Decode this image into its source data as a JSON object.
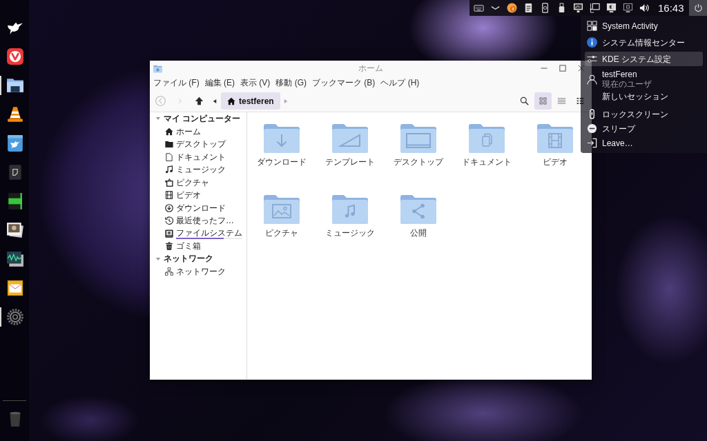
{
  "top_panel": {
    "clock": "16:43",
    "power_button": {
      "active": true
    }
  },
  "dock": {
    "items": [
      {
        "running": false
      },
      {
        "running": false
      },
      {
        "running": true
      },
      {
        "running": false
      },
      {
        "running": false
      },
      {
        "running": false
      },
      {
        "running": false
      },
      {
        "running": false
      },
      {
        "running": false
      },
      {
        "running": false
      },
      {
        "running": true
      }
    ]
  },
  "window": {
    "title": "ホーム",
    "menu": [
      "ファイル (F)",
      "編集 (E)",
      "表示 (V)",
      "移動 (G)",
      "ブックマーク (B)",
      "ヘルプ (H)"
    ],
    "toolbar": {
      "nav": [
        {
          "disabled": true
        },
        {
          "disabled": true
        },
        {
          "disabled": false
        }
      ],
      "breadcrumb": "testferen",
      "view_modes": [
        {
          "selected": true
        },
        {
          "selected": false
        },
        {
          "selected": false
        }
      ]
    },
    "places": [
      {
        "label": "マイ コンピューター",
        "expanded": true,
        "children": [
          {
            "label": "ホーム"
          },
          {
            "label": "デスクトップ"
          },
          {
            "label": "ドキュメント"
          },
          {
            "label": "ミュージック"
          },
          {
            "label": "ピクチャ"
          },
          {
            "label": "ビデオ"
          },
          {
            "label": "ダウンロード"
          },
          {
            "label": "最近使ったフ…"
          },
          {
            "label": "ファイルシステム",
            "level": 0.72
          },
          {
            "label": "ゴミ箱"
          }
        ]
      },
      {
        "label": "ネットワーク",
        "expanded": true,
        "children": [
          {
            "label": "ネットワーク"
          }
        ]
      }
    ],
    "folders": [
      {
        "label": "ダウンロード"
      },
      {
        "label": "テンプレート"
      },
      {
        "label": "デスクトップ"
      },
      {
        "label": "ドキュメント"
      },
      {
        "label": "ビデオ"
      },
      {
        "label": "ピクチャ"
      },
      {
        "label": "ミュージック"
      },
      {
        "label": "公開"
      }
    ]
  },
  "session_menu": {
    "groups": [
      {
        "items": [
          {
            "label": "System Activity",
            "selected": false
          },
          {
            "label": "システム情報センター",
            "selected": false
          },
          {
            "label": "KDE システム設定",
            "selected": true
          }
        ]
      },
      {
        "items": [
          {
            "label": "testFeren",
            "caption": "現在のユーザ",
            "selected": false
          },
          {
            "label": "新しいセッション",
            "selected": false
          }
        ]
      },
      {
        "items": [
          {
            "label": "ロックスクリーン",
            "selected": false
          },
          {
            "label": "スリープ",
            "selected": false
          },
          {
            "label": "Leave…",
            "selected": false
          }
        ]
      }
    ]
  }
}
